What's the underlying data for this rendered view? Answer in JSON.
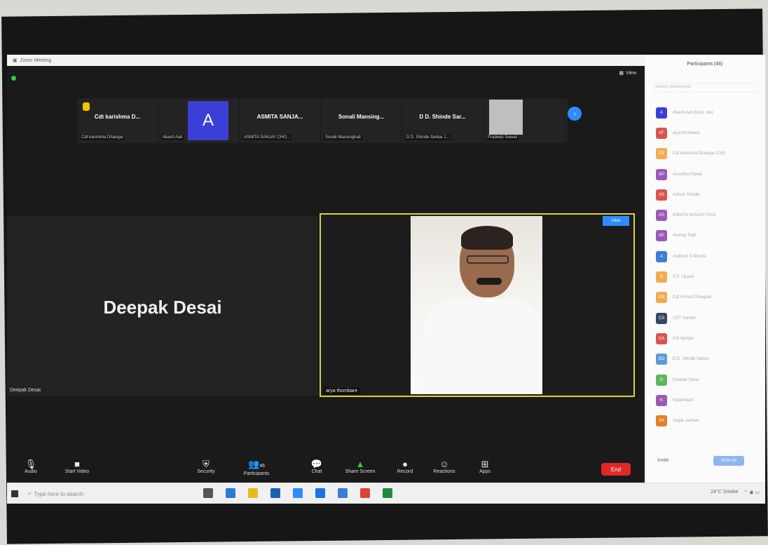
{
  "window": {
    "title": "Zoom Meeting",
    "view_label": "View"
  },
  "thumbnails": [
    {
      "big": "Cdt karishma D...",
      "small": "Cdt karishma Dhangar",
      "kind": "hand"
    },
    {
      "big": "A",
      "small": "Akash Aali",
      "kind": "avatar"
    },
    {
      "big": "ASMITA SANJA...",
      "small": "ASMITA SANJAY CHO...",
      "kind": "name"
    },
    {
      "big": "Sonali Mansing...",
      "small": "Sonali Mansinghati",
      "kind": "name"
    },
    {
      "big": "D D. Shinde Sar...",
      "small": "D D. Shinde Sarkar J...",
      "kind": "name"
    },
    {
      "big": "",
      "small": "Pradeep Sawali",
      "kind": "photo"
    }
  ],
  "main_left": {
    "name": "Deepak Desai",
    "label": "Deepak Desai"
  },
  "main_video": {
    "label": "arya thombare",
    "badge": "View"
  },
  "toolbar": {
    "audio": "Audio",
    "video": "Start Video",
    "security": "Security",
    "participants": "Participants",
    "participants_count": "46",
    "chat": "Chat",
    "share": "Share Screen",
    "record": "Record",
    "reactions": "Reactions",
    "apps": "Apps",
    "end": "End"
  },
  "panel": {
    "title": "Participants (46)",
    "search_placeholder": "Search participants",
    "invite": "Invite",
    "mute_all": "Mute All",
    "participants": [
      {
        "initials": "A",
        "name": "Akash Aali (Host, me)",
        "color": "#3b3fd6"
      },
      {
        "initials": "AT",
        "name": "arya thombare",
        "color": "#d9534f"
      },
      {
        "initials": "CK",
        "name": "Cdt karishma Dhangar (Cdt)",
        "color": "#f0ad4e"
      },
      {
        "initials": "AP",
        "name": "Anushka Pawar",
        "color": "#9b59b6"
      },
      {
        "initials": "AS",
        "name": "Ashish Shinde",
        "color": "#d9534f"
      },
      {
        "initials": "AS",
        "name": "ASMITA SANJAY CHO",
        "color": "#9b59b6"
      },
      {
        "initials": "AP",
        "name": "Akshay Patil",
        "color": "#9b59b6"
      },
      {
        "initials": "A",
        "name": "Avdhoot S Bhosle",
        "color": "#3b7dd8"
      },
      {
        "initials": "S",
        "name": "S.P. Lipane",
        "color": "#f0ad4e"
      },
      {
        "initials": "CK",
        "name": "Cdt Komal Chougule",
        "color": "#f0ad4e"
      },
      {
        "initials": "CS",
        "name": "CDT Sanket",
        "color": "#34495e"
      },
      {
        "initials": "CA",
        "name": "Cdt Ajinkya",
        "color": "#d9534f"
      },
      {
        "initials": "DD",
        "name": "D.D. Shinde Sarkar",
        "color": "#5b9bd5"
      },
      {
        "initials": "D",
        "name": "Deepak Desai",
        "color": "#5cb85c"
      },
      {
        "initials": "K",
        "name": "Kadambari",
        "color": "#9b59b6"
      },
      {
        "initials": "SA",
        "name": "Sagar Jadhav",
        "color": "#e67e22"
      }
    ]
  },
  "taskbar": {
    "search_placeholder": "Type here to search",
    "tray": "24°C Smoke"
  }
}
